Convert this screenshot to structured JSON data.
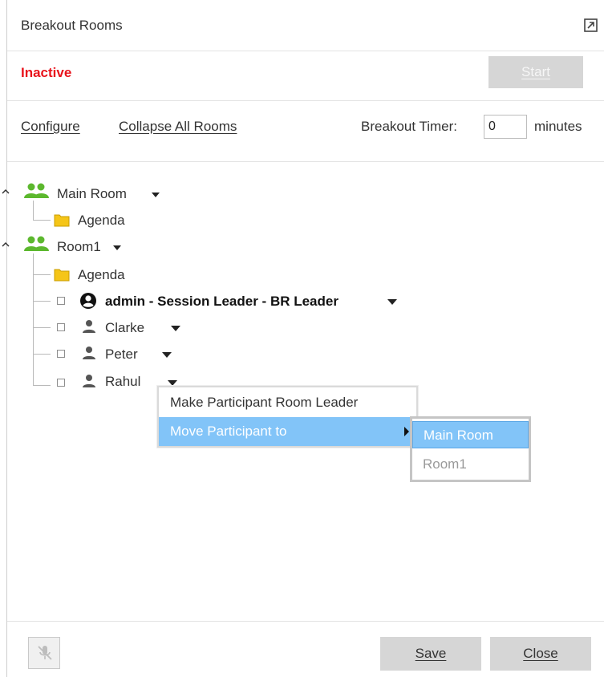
{
  "window": {
    "title": "Breakout Rooms",
    "popout_icon": "popout-icon"
  },
  "status": {
    "text": "Inactive",
    "color": "#e8131c",
    "start_label": "Start"
  },
  "toolbar": {
    "configure_label": "Configure",
    "collapse_label": "Collapse All Rooms",
    "timer_label": "Breakout Timer:",
    "timer_value": "0",
    "timer_unit": "minutes"
  },
  "tree": {
    "main_room": {
      "label": "Main Room",
      "agenda": "Agenda"
    },
    "room1": {
      "label": "Room1",
      "agenda": "Agenda",
      "participants": [
        {
          "name": "admin - Session Leader - BR Leader",
          "icon": "account-circle-icon",
          "bold": true
        },
        {
          "name": "Clarke",
          "icon": "person-icon",
          "bold": false
        },
        {
          "name": "Peter",
          "icon": "person-icon",
          "bold": false
        },
        {
          "name": "Rahul",
          "icon": "person-icon",
          "bold": false
        }
      ]
    }
  },
  "context_menu": {
    "items": [
      "Make Participant Room Leader",
      "Move Participant to"
    ],
    "submenu": [
      "Main Room",
      "Room1"
    ]
  },
  "footer": {
    "mic_icon": "mic-off-icon",
    "save_label": "Save",
    "close_label": "Close"
  },
  "colors": {
    "accent_blue": "#82c4f8",
    "room_icon_green": "#5cb82e",
    "folder_yellow": "#f5c518"
  }
}
